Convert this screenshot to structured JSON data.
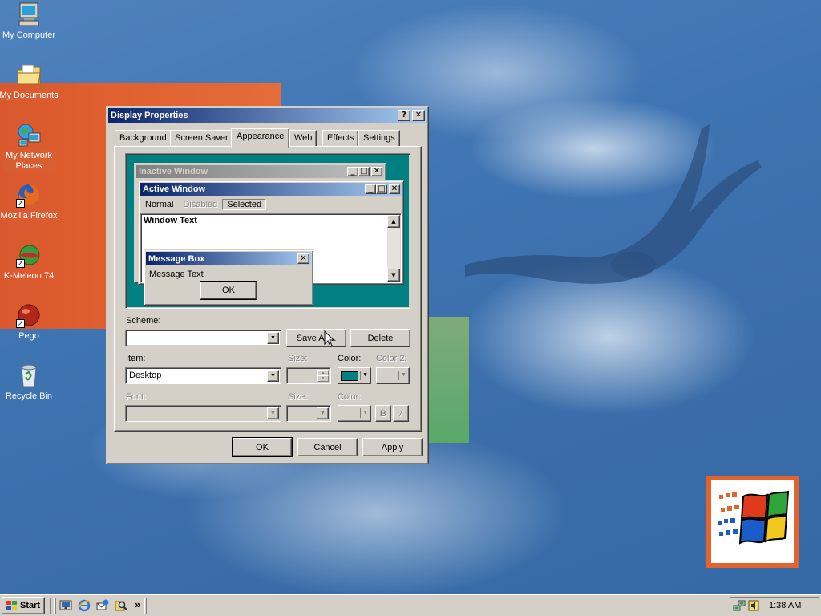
{
  "desktop_icons": [
    {
      "label": "My Computer",
      "icon": "computer-icon"
    },
    {
      "label": "My Documents",
      "icon": "folder-documents-icon"
    },
    {
      "label": "My Network Places",
      "icon": "network-places-icon"
    },
    {
      "label": "Mozilla Firefox",
      "icon": "firefox-icon"
    },
    {
      "label": "K-Meleon 74",
      "icon": "kmeleon-icon"
    },
    {
      "label": "Pego",
      "icon": "pego-icon"
    },
    {
      "label": "Recycle Bin",
      "icon": "recycle-bin-icon"
    }
  ],
  "dialog": {
    "title": "Display Properties",
    "help_glyph": "?",
    "close_glyph": "✕",
    "tabs": [
      "Background",
      "Screen Saver",
      "Appearance",
      "Web",
      "Effects",
      "Settings"
    ],
    "active_tab": "Appearance",
    "preview": {
      "inactive_title": "Inactive Window",
      "active_title": "Active Window",
      "menu_items": [
        "Normal",
        "Disabled",
        "Selected"
      ],
      "window_text": "Window Text",
      "message_box_title": "Message Box",
      "message_text": "Message Text",
      "ok_label": "OK",
      "background_color": "#008080"
    },
    "scheme_label": "Scheme:",
    "scheme_value": "",
    "save_as_label": "Save As...",
    "delete_label": "Delete",
    "item_label": "Item:",
    "item_value": "Desktop",
    "size_label": "Size:",
    "color_label": "Color:",
    "color2_label": "Color 2:",
    "font_label": "Font:",
    "font_size_label": "Size:",
    "font_color_label": "Color:",
    "bold_label": "B",
    "italic_label": "/",
    "selected_color": "#008080",
    "ok_label": "OK",
    "cancel_label": "Cancel",
    "apply_label": "Apply"
  },
  "taskbar": {
    "start_label": "Start",
    "quick_launch": [
      "show-desktop-icon",
      "internet-explorer-icon",
      "outlook-express-icon",
      "search-icon"
    ],
    "more_glyph": "»",
    "tray_icons": [
      "network-tray-icon",
      "volume-tray-icon"
    ],
    "clock": "1:38 AM"
  }
}
